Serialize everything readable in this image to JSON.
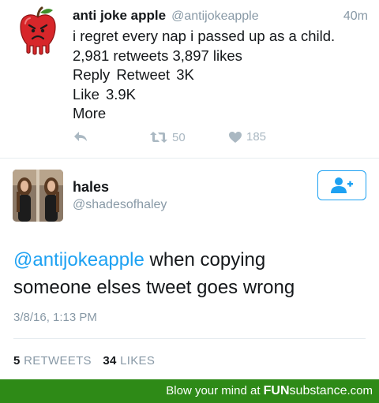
{
  "tweet1": {
    "name": "anti joke apple",
    "handle": "@antijokeapple",
    "time": "40m",
    "text": "i regret every nap i passed up as a child.",
    "stats_line": "2,981 retweets 3,897 likes",
    "reply_label": "Reply",
    "retweet_label": "Retweet",
    "retweet_count_text": "3K",
    "like_label": "Like",
    "like_count_text": "3.9K",
    "more_label": "More",
    "action_retweet_count": "50",
    "action_like_count": "185"
  },
  "tweet2": {
    "name": "hales",
    "handle": "@shadesofhaley",
    "mention": "@antijokeapple",
    "text_line1_rest": " when copying",
    "text_line2": "someone elses tweet goes wrong",
    "date": "3/8/16, 1:13 PM",
    "retweets_count": "5",
    "retweets_label": "RETWEETS",
    "likes_count": "34",
    "likes_label": "LIKES"
  },
  "footer": {
    "prefix": "Blow your mind at",
    "brand_bold": "FUN",
    "brand_rest": "substance",
    "suffix": ".com"
  },
  "icons": {
    "apple_avatar": "angry-apple-icon",
    "reply": "reply-icon",
    "retweet": "retweet-icon",
    "like": "heart-icon",
    "follow": "add-user-icon"
  },
  "colors": {
    "accent_blue": "#1da1f2",
    "muted_gray": "#8899a6",
    "footer_green": "#2e8a17",
    "apple_red": "#d7262a"
  }
}
